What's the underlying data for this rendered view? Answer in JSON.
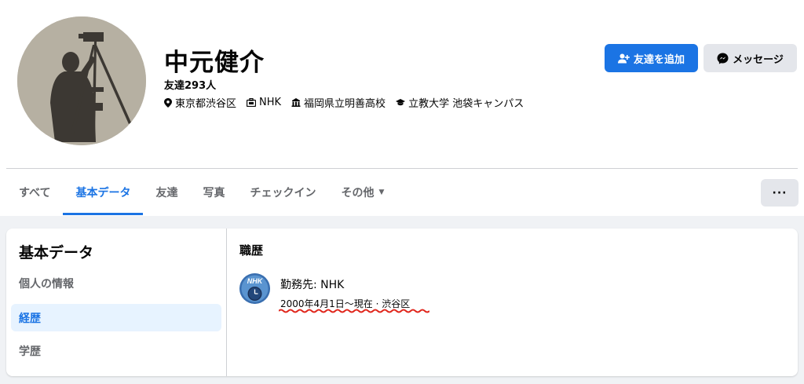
{
  "profile": {
    "name": "中元健介",
    "friends": "友達293人",
    "location": "東京都渋谷区",
    "work": "NHK",
    "high_school": "福岡県立明善高校",
    "university": "立教大学 池袋キャンパス",
    "add_friend_label": "友達を追加",
    "message_label": "メッセージ"
  },
  "tabs": [
    {
      "label": "すべて"
    },
    {
      "label": "基本データ"
    },
    {
      "label": "友達"
    },
    {
      "label": "写真"
    },
    {
      "label": "チェックイン"
    },
    {
      "label": "その他"
    }
  ],
  "more_label": "···",
  "about": {
    "title": "基本データ",
    "nav": [
      {
        "label": "個人の情報"
      },
      {
        "label": "経歴"
      },
      {
        "label": "学歴"
      }
    ],
    "section_title": "職歴",
    "work_title": "勤務先: NHK",
    "work_detail": "2000年4月1日〜現在 · 渋谷区",
    "work_logo_text": "NHK"
  },
  "colors": {
    "accent": "#1b74e4",
    "secondary_button": "#e4e6eb",
    "active_nav_bg": "#e7f3ff",
    "annotation_red": "#e0261c"
  },
  "icons": [
    "location-pin-icon",
    "briefcase-icon",
    "school-icon",
    "graduation-cap-icon",
    "add-friend-icon",
    "messenger-icon",
    "caret-down-icon"
  ]
}
